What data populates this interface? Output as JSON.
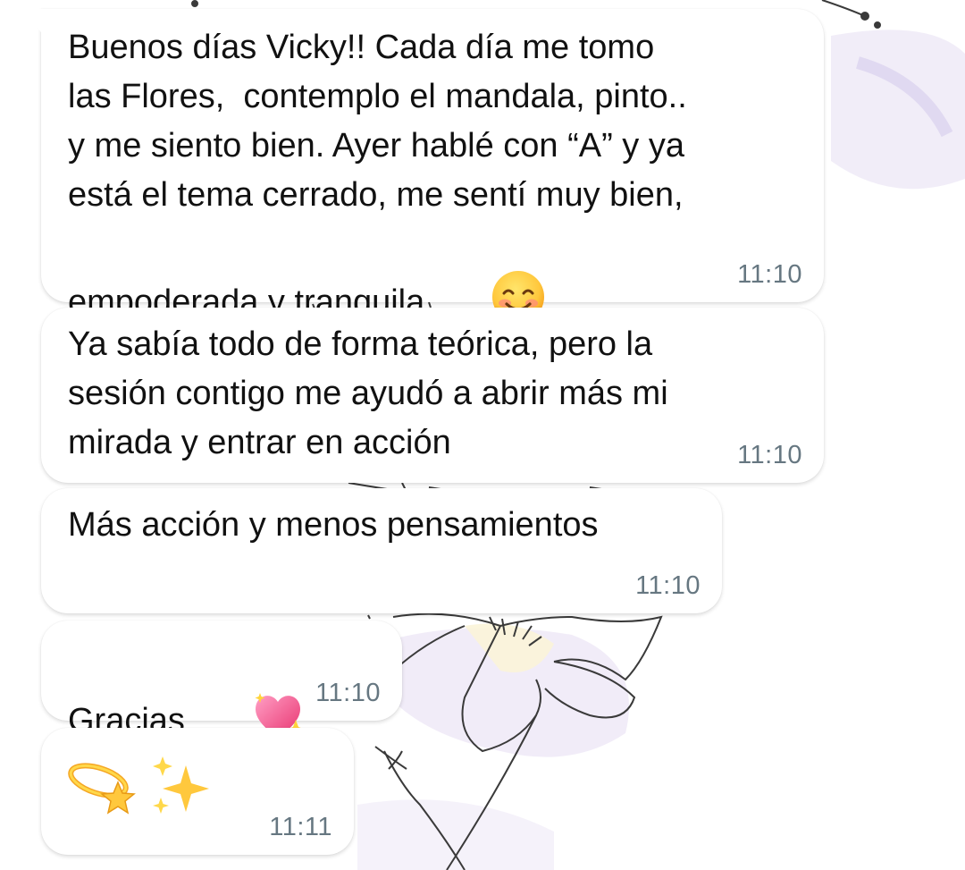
{
  "chat": {
    "messages": [
      {
        "text": "Buenos días Vicky!! Cada día me tomo\nlas Flores,  contemplo el mandala, pinto..\ny me siento bien. Ayer hablé con “A” y ya\nestá el tema cerrado, me sentí muy bien,\nempoderada y tranquila",
        "emoji": "smiling-face-with-smiling-eyes",
        "time": "11:10"
      },
      {
        "text": "Ya sabía todo de forma teórica, pero la\nsesión contigo me ayudó a abrir más mi\nmirada y entrar en acción",
        "time": "11:10"
      },
      {
        "text": "Más acción y menos pensamientos",
        "time": "11:10"
      },
      {
        "text": "Gracias",
        "emoji": "sparkling-heart",
        "time": "11:10"
      },
      {
        "text": "",
        "emojis": [
          "dizzy-star",
          "sparkles"
        ],
        "time": "11:11"
      }
    ]
  },
  "colors": {
    "bubble": "#ffffff",
    "text": "#111111",
    "timestamp": "#667781",
    "wallpaper_lines": "#3a3a3a",
    "wallpaper_tint": "#e9e4f4"
  }
}
